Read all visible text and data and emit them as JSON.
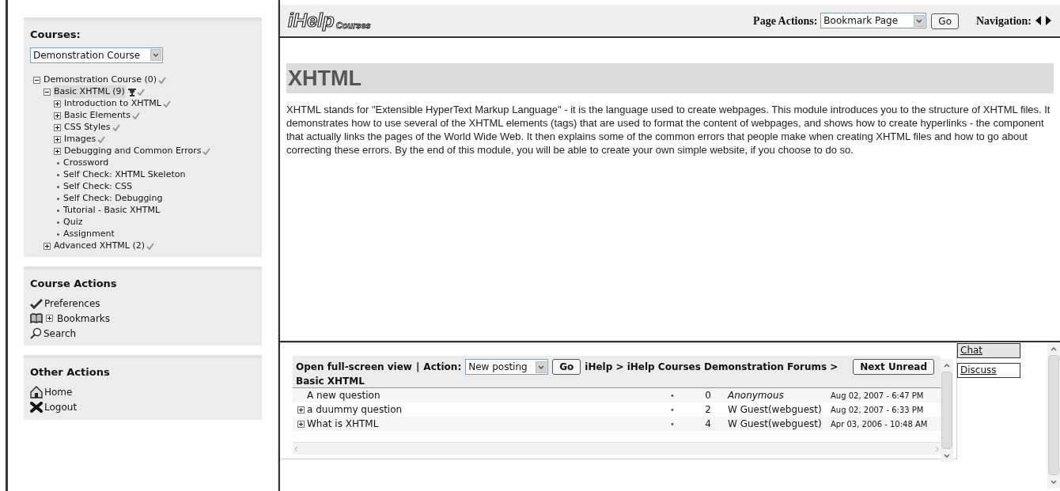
{
  "sidebar": {
    "courses_panel": {
      "title": "Courses:",
      "course_select": "Demonstration Course",
      "tree": [
        {
          "label": "Demonstration Course (0)",
          "kind": "folder",
          "expanded": true,
          "selected": false,
          "completed": true,
          "children": [
            {
              "label": "Basic XHTML (9)",
              "kind": "folder",
              "expanded": true,
              "selected": true,
              "completed": true,
              "trophy": true,
              "children": [
                {
                  "label": "Introduction to XHTML",
                  "kind": "folder",
                  "expanded": false,
                  "selected": false,
                  "completed": true
                },
                {
                  "label": "Basic Elements",
                  "kind": "folder",
                  "expanded": false,
                  "selected": false,
                  "completed": true
                },
                {
                  "label": "CSS Styles",
                  "kind": "folder",
                  "expanded": false,
                  "selected": false,
                  "completed": true
                },
                {
                  "label": "Images",
                  "kind": "folder",
                  "expanded": false,
                  "selected": false,
                  "completed": true
                },
                {
                  "label": "Debugging and Common Errors",
                  "kind": "folder",
                  "expanded": false,
                  "selected": false,
                  "completed": true
                },
                {
                  "label": "Crossword",
                  "kind": "leaf",
                  "selected": false,
                  "completed": false
                },
                {
                  "label": "Self Check: XHTML Skeleton",
                  "kind": "leaf",
                  "selected": false,
                  "completed": false
                },
                {
                  "label": "Self Check: CSS",
                  "kind": "leaf",
                  "selected": false,
                  "completed": false
                },
                {
                  "label": "Self Check: Debugging",
                  "kind": "leaf",
                  "selected": false,
                  "completed": false
                },
                {
                  "label": "Tutorial - Basic XHTML",
                  "kind": "leaf",
                  "selected": false,
                  "completed": false
                },
                {
                  "label": "Quiz",
                  "kind": "leaf",
                  "selected": false,
                  "completed": false
                },
                {
                  "label": "Assignment",
                  "kind": "leaf",
                  "selected": false,
                  "completed": false
                }
              ]
            },
            {
              "label": "Advanced XHTML (2)",
              "kind": "folder",
              "expanded": false,
              "selected": false,
              "completed": true
            }
          ]
        }
      ]
    },
    "course_actions": {
      "title": "Course Actions",
      "items": [
        {
          "label": "Preferences",
          "kind": "preferences"
        },
        {
          "label": "Bookmarks",
          "kind": "bookmarks"
        },
        {
          "label": "Search",
          "kind": "search"
        }
      ]
    },
    "other_actions": {
      "title": "Other Actions",
      "items": [
        {
          "label": "Home",
          "kind": "home"
        },
        {
          "label": "Logout",
          "kind": "logout"
        }
      ]
    }
  },
  "header": {
    "logo_main": "iHelp",
    "logo_sub": "Courses",
    "page_actions_label": "Page Actions:",
    "page_actions_select": "Bookmark Page",
    "go": "Go",
    "navigation_label": "Navigation:"
  },
  "content": {
    "title": "XHTML",
    "body": "XHTML stands for \"Extensible HyperText Markup Language\" - it is the language used to create webpages. This module introduces you to the structure of XHTML files. It demonstrates how to use several of the XHTML elements (tags) that are used to format the content of webpages, and shows how to create hyperlinks - the component that actually links the pages of the World Wide Web. It then explains some of the common errors that people make when creating XHTML files and how to go about correcting these errors. By the end of this module, you will be able to create your own simple website, if you choose to do so."
  },
  "forum": {
    "full_screen": "Open full-screen view",
    "separator": "|",
    "action_label": "Action:",
    "action_select": "New posting",
    "go": "Go",
    "breadcrumb": "iHelp > iHelp Courses Demonstration Forums >",
    "next_unread": "Next Unread",
    "forum_title": "Basic XHTML",
    "threads": [
      {
        "subject": "A new question",
        "expandable": false,
        "dot": "•",
        "replies": "0",
        "author": "Anonymous",
        "anonymous": true,
        "date": "Aug 02, 2007 - 6:47 PM"
      },
      {
        "subject": "a duummy question",
        "expandable": true,
        "dot": "•",
        "replies": "2",
        "author": "W Guest(webguest)",
        "anonymous": false,
        "date": "Aug 02, 2007 - 6:33 PM"
      },
      {
        "subject": "What is XHTML",
        "expandable": true,
        "dot": "•",
        "replies": "4",
        "author": "W Guest(webguest)",
        "anonymous": false,
        "date": "Apr 03, 2006 - 10:48 AM"
      }
    ]
  },
  "side_tabs": [
    {
      "label": "Chat",
      "selected": true
    },
    {
      "label": "Discuss",
      "selected": false
    }
  ]
}
